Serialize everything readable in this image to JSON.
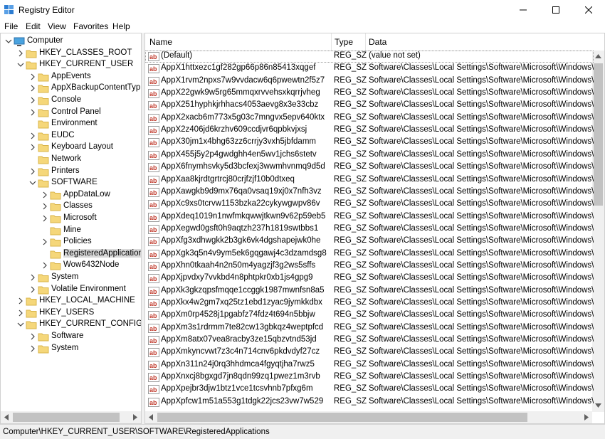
{
  "window": {
    "title": "Registry Editor"
  },
  "menu": [
    "File",
    "Edit",
    "View",
    "Favorites",
    "Help"
  ],
  "tree": [
    {
      "label": "Computer",
      "depth": 0,
      "expanded": true,
      "icon": "computer-icon"
    },
    {
      "label": "HKEY_CLASSES_ROOT",
      "depth": 1,
      "expanded": false
    },
    {
      "label": "HKEY_CURRENT_USER",
      "depth": 1,
      "expanded": true
    },
    {
      "label": "AppEvents",
      "depth": 2,
      "expanded": false
    },
    {
      "label": "AppXBackupContentTyp",
      "depth": 2,
      "expanded": false
    },
    {
      "label": "Console",
      "depth": 2,
      "expanded": false
    },
    {
      "label": "Control Panel",
      "depth": 2,
      "expanded": false
    },
    {
      "label": "Environment",
      "depth": 2,
      "expanded": null
    },
    {
      "label": "EUDC",
      "depth": 2,
      "expanded": false
    },
    {
      "label": "Keyboard Layout",
      "depth": 2,
      "expanded": false
    },
    {
      "label": "Network",
      "depth": 2,
      "expanded": null
    },
    {
      "label": "Printers",
      "depth": 2,
      "expanded": false
    },
    {
      "label": "SOFTWARE",
      "depth": 2,
      "expanded": true
    },
    {
      "label": "AppDataLow",
      "depth": 3,
      "expanded": false
    },
    {
      "label": "Classes",
      "depth": 3,
      "expanded": false
    },
    {
      "label": "Microsoft",
      "depth": 3,
      "expanded": false
    },
    {
      "label": "Mine",
      "depth": 3,
      "expanded": null
    },
    {
      "label": "Policies",
      "depth": 3,
      "expanded": false
    },
    {
      "label": "RegisteredApplication",
      "depth": 3,
      "expanded": null,
      "selected": true
    },
    {
      "label": "Wow6432Node",
      "depth": 3,
      "expanded": false
    },
    {
      "label": "System",
      "depth": 2,
      "expanded": false
    },
    {
      "label": "Volatile Environment",
      "depth": 2,
      "expanded": false
    },
    {
      "label": "HKEY_LOCAL_MACHINE",
      "depth": 1,
      "expanded": false
    },
    {
      "label": "HKEY_USERS",
      "depth": 1,
      "expanded": false
    },
    {
      "label": "HKEY_CURRENT_CONFIG",
      "depth": 1,
      "expanded": true
    },
    {
      "label": "Software",
      "depth": 2,
      "expanded": false
    },
    {
      "label": "System",
      "depth": 2,
      "expanded": false
    }
  ],
  "columns": {
    "name": "Name",
    "type": "Type",
    "data": "Data"
  },
  "values": [
    {
      "name": "(Default)",
      "type": "REG_SZ",
      "data": "(value not set)"
    },
    {
      "name": "AppX1httxezc1gf282gp66p86n85413xqgef",
      "type": "REG_SZ",
      "data": "Software\\Classes\\Local Settings\\Software\\Microsoft\\Windows\\Cu"
    },
    {
      "name": "AppX1rvm2npxs7w9vvdacw6q6pwewtn2f5z7",
      "type": "REG_SZ",
      "data": "Software\\Classes\\Local Settings\\Software\\Microsoft\\Windows\\Cu"
    },
    {
      "name": "AppX22gwk9w5rg65mmqxrvvehsxkqrrjvheg",
      "type": "REG_SZ",
      "data": "Software\\Classes\\Local Settings\\Software\\Microsoft\\Windows\\Cu"
    },
    {
      "name": "AppX251hyphkjrhhacs4053aevg8x3e33cbz",
      "type": "REG_SZ",
      "data": "Software\\Classes\\Local Settings\\Software\\Microsoft\\Windows\\Cu"
    },
    {
      "name": "AppX2xacb6m773x5g03c7mngvx5epv640ktx",
      "type": "REG_SZ",
      "data": "Software\\Classes\\Local Settings\\Software\\Microsoft\\Windows\\Cu"
    },
    {
      "name": "AppX2z406jd6krzhv609ccdjvr6qpbkvjxsj",
      "type": "REG_SZ",
      "data": "Software\\Classes\\Local Settings\\Software\\Microsoft\\Windows\\Cu"
    },
    {
      "name": "AppX30jm1x4bhg63zz6crrjy3vxh5jbfdamm",
      "type": "REG_SZ",
      "data": "Software\\Classes\\Local Settings\\Software\\Microsoft\\Windows\\Cu"
    },
    {
      "name": "AppX455j5y2p4gwdghh4en5wv1jchs6stetv",
      "type": "REG_SZ",
      "data": "Software\\Classes\\Local Settings\\Software\\Microsoft\\Windows\\Cu"
    },
    {
      "name": "AppX6fnymhsvky5d3bcfexj3wwmhvnmq9d5d",
      "type": "REG_SZ",
      "data": "Software\\Classes\\Local Settings\\Software\\Microsoft\\Windows\\Cu"
    },
    {
      "name": "AppXaa8kjrdtgrtrcj80crjfzjf10b0dtxeq",
      "type": "REG_SZ",
      "data": "Software\\Classes\\Local Settings\\Software\\Microsoft\\Windows\\Cu"
    },
    {
      "name": "AppXawgkb9d9mx76qa0vsaq19xj0x7nfh3vz",
      "type": "REG_SZ",
      "data": "Software\\Classes\\Local Settings\\Software\\Microsoft\\Windows\\Cu"
    },
    {
      "name": "AppXc9xs0tcrvw1153bzka22cykywgwpv86v",
      "type": "REG_SZ",
      "data": "Software\\Classes\\Local Settings\\Software\\Microsoft\\Windows\\Cu"
    },
    {
      "name": "AppXdeq1019n1nwfmkqwwjtkwn9v62p59eb5",
      "type": "REG_SZ",
      "data": "Software\\Classes\\Local Settings\\Software\\Microsoft\\Windows\\Cu"
    },
    {
      "name": "AppXegwd0gsft0h9aqtzh237h1819swtbbs1",
      "type": "REG_SZ",
      "data": "Software\\Classes\\Local Settings\\Software\\Microsoft\\Windows\\Cu"
    },
    {
      "name": "AppXfg3xdhwgkk2b3gk6vk4dgshapejwk0he",
      "type": "REG_SZ",
      "data": "Software\\Classes\\Local Settings\\Software\\Microsoft\\Windows\\Cu"
    },
    {
      "name": "AppXgk3q5n4v9ym5ek6gqgawj4c3dzamdsg8",
      "type": "REG_SZ",
      "data": "Software\\Classes\\Local Settings\\Software\\Microsoft\\Windows\\Cu"
    },
    {
      "name": "AppXhn0tkaah4n2n50m4yagzjf3g2ws5sffs",
      "type": "REG_SZ",
      "data": "Software\\Classes\\Local Settings\\Software\\Microsoft\\Windows\\Cu"
    },
    {
      "name": "AppXjpvdxy7vvkbd4n8phtpkr0xb1js4gpg9",
      "type": "REG_SZ",
      "data": "Software\\Classes\\Local Settings\\Software\\Microsoft\\Windows\\Cu"
    },
    {
      "name": "AppXk3gkzqpsfmqqe1ccggk1987mwnfsn8a5",
      "type": "REG_SZ",
      "data": "Software\\Classes\\Local Settings\\Software\\Microsoft\\Windows\\Cu"
    },
    {
      "name": "AppXkx4w2gm7xq25tz1ebd1zyac9jymkkdbx",
      "type": "REG_SZ",
      "data": "Software\\Classes\\Local Settings\\Software\\Microsoft\\Windows\\Cu"
    },
    {
      "name": "AppXm0rp4528j1pgabfz74fdz4t694n5bbjw",
      "type": "REG_SZ",
      "data": "Software\\Classes\\Local Settings\\Software\\Microsoft\\Windows\\Cu"
    },
    {
      "name": "AppXm3s1rdrmm7te82cw13gbkqz4weptpfcd",
      "type": "REG_SZ",
      "data": "Software\\Classes\\Local Settings\\Software\\Microsoft\\Windows\\Cu"
    },
    {
      "name": "AppXm8atx07vea8racby3ze15qbzvtnd53jd",
      "type": "REG_SZ",
      "data": "Software\\Classes\\Local Settings\\Software\\Microsoft\\Windows\\Cu"
    },
    {
      "name": "AppXmkyncvwt7z3c4n714cnv6pkdvdyf27cz",
      "type": "REG_SZ",
      "data": "Software\\Classes\\Local Settings\\Software\\Microsoft\\Windows\\Cu"
    },
    {
      "name": "AppXn311n24j0rq3hhdmca4fgyqtjha7rwz5",
      "type": "REG_SZ",
      "data": "Software\\Classes\\Local Settings\\Software\\Microsoft\\Windows\\Cu"
    },
    {
      "name": "AppXnxcj8bgxgd7jn8qdn99zq1pwez1m3rvb",
      "type": "REG_SZ",
      "data": "Software\\Classes\\Local Settings\\Software\\Microsoft\\Windows\\Cu"
    },
    {
      "name": "AppXpejbr3djw1btz1vce1tcsvhnb7pfxg6m",
      "type": "REG_SZ",
      "data": "Software\\Classes\\Local Settings\\Software\\Microsoft\\Windows\\Cu"
    },
    {
      "name": "AppXpfcw1m51a553g1tdgk22jcs23vw7w529",
      "type": "REG_SZ",
      "data": "Software\\Classes\\Local Settings\\Software\\Microsoft\\Windows\\Cu"
    }
  ],
  "status": {
    "path": "Computer\\HKEY_CURRENT_USER\\SOFTWARE\\RegisteredApplications"
  },
  "colors": {
    "folder": "#f5d77a",
    "folder_edge": "#d9b44a",
    "selection": "#d9d9d9",
    "ab_icon": "#c0392b"
  }
}
